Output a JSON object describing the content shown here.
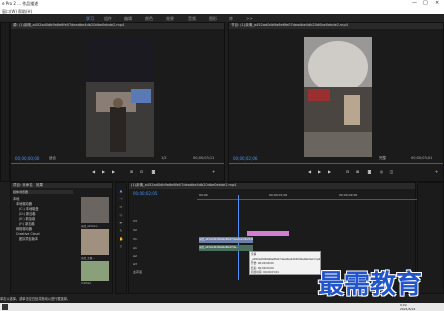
{
  "window": {
    "title": "e Pro 2 ... 作品描述",
    "minimize": "—",
    "maximize": "□",
    "close": "×"
  },
  "menu": [
    "窗口(W)",
    "帮助(H)"
  ],
  "workspaces": [
    "学习",
    "组件",
    "编辑",
    "颜色",
    "效果",
    "音频",
    "图形",
    "库",
    ">>"
  ],
  "source": {
    "header": "源: (1)亲情_a452ad0db9a6e6fe07deadbe4db20dbe0ebde2.mp4",
    "timecode": "00;00;00;00",
    "fit": "适合",
    "scale": "1/2",
    "duration": "00;00;03;11"
  },
  "program": {
    "header": "节目: (1)亲情_a452ad0db9a6e6fe07deadbe4db20d0be0ebde2.mp4",
    "timecode": "00;00;02;06",
    "fit": "完整",
    "duration": "00;00;03;01"
  },
  "project": {
    "tabs": [
      "项目: 未命名",
      "效果",
      "媒体浏览器",
      "信息",
      "效果控件"
    ],
    "items": [
      "本地",
      "本地驱动器",
      "(C:) 本地磁盘",
      "(D:) 新加卷",
      "(E:) 新加卷",
      "(F:) 新加卷",
      "网络驱动器",
      "Creative Cloud",
      "团队项目版本"
    ],
    "thumbs": [
      "亲情_a452ad...",
      "亲情_主题...",
      "Untitled"
    ]
  },
  "timeline": {
    "header": "(1)亲情_a452ad0db9a6e6fe07deadbe4db20dbe0ebde2.mp4",
    "timecode": "00;00;02;05",
    "ruler": [
      "00;00",
      "00;00;01;00",
      "00;00;02;00"
    ],
    "tracks": [
      "V3",
      "V2",
      "V1",
      "A1",
      "A2",
      "A3",
      "主声道"
    ],
    "clip_v1": "亲情_a452ad0db9a6e6fe07deadbe4db20dbe0ebde2.mp4 [V]",
    "clip_a1": "亲情_a452ad0db9a6e6fe07de...",
    "tooltip": [
      "亲情_a452ad0db9a6e6fe07deadbe4db20dbe0ebde2.mp4",
      "开始: 00;00;00;00",
      "结束: 00;00;03;00",
      "持续时间: 00;00;03;01"
    ]
  },
  "watermark": "最需教育",
  "status": "单击以选择，或单击空白处并拖动以进行框选择。",
  "clock": {
    "time": "9:02",
    "date": "2021/6/24"
  }
}
